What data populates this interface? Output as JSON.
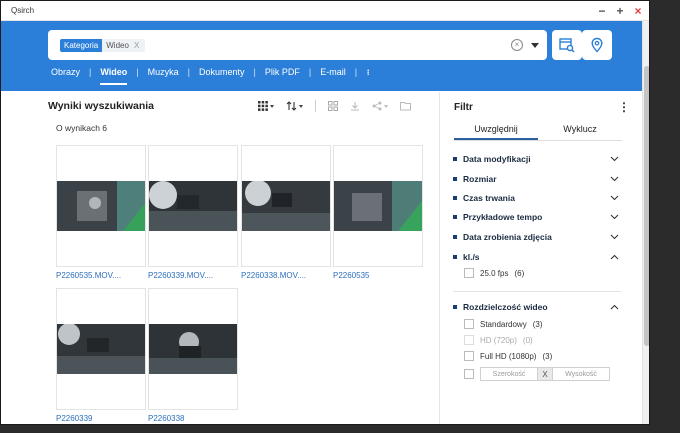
{
  "window": {
    "title": "Qsirch",
    "controls": {
      "minimize": "−",
      "maximize": "+",
      "close": "×"
    }
  },
  "search": {
    "chip_category": "Kategoria",
    "chip_value": "Wideo",
    "chip_remove": "X"
  },
  "tabs": [
    {
      "label": "Obrazy"
    },
    {
      "label": "Wideo",
      "active": true
    },
    {
      "label": "Muzyka"
    },
    {
      "label": "Dokumenty"
    },
    {
      "label": "Plik PDF"
    },
    {
      "label": "E-mail"
    }
  ],
  "results": {
    "title": "Wyniki wyszukiwania",
    "count": "O wynikach 6",
    "items": [
      {
        "name": "P2260535.MOV...."
      },
      {
        "name": "P2260339.MOV...."
      },
      {
        "name": "P2260338.MOV...."
      },
      {
        "name": "P2260535"
      },
      {
        "name": "P2260339"
      },
      {
        "name": "P2260338"
      }
    ]
  },
  "filter": {
    "title": "Filtr",
    "tabs": {
      "include": "Uwzględnij",
      "exclude": "Wyklucz"
    },
    "sections": [
      {
        "label": "Data modyfikacji",
        "expanded": false
      },
      {
        "label": "Rozmiar",
        "expanded": false
      },
      {
        "label": "Czas trwania",
        "expanded": false
      },
      {
        "label": "Przykładowe tempo",
        "expanded": false
      },
      {
        "label": "Data zrobienia zdjęcia",
        "expanded": false
      },
      {
        "label": "kl./s",
        "expanded": true
      },
      {
        "label": "Rozdzielczość wideo",
        "expanded": true
      }
    ],
    "fps_options": [
      {
        "label": "25.0 fps",
        "count": "(6)"
      }
    ],
    "resolution_options": [
      {
        "label": "Standardowy",
        "count": "(3)",
        "enabled": true
      },
      {
        "label": "HD (720p)",
        "count": "(0)",
        "enabled": false
      },
      {
        "label": "Full HD (1080p)",
        "count": "(3)",
        "enabled": true
      }
    ],
    "custom": {
      "width_placeholder": "Szerokość",
      "times": "X",
      "height_placeholder": "Wysokość"
    }
  },
  "colors": {
    "accent": "#2c7fd8",
    "link": "#2c6ebd",
    "close": "#e04040"
  }
}
